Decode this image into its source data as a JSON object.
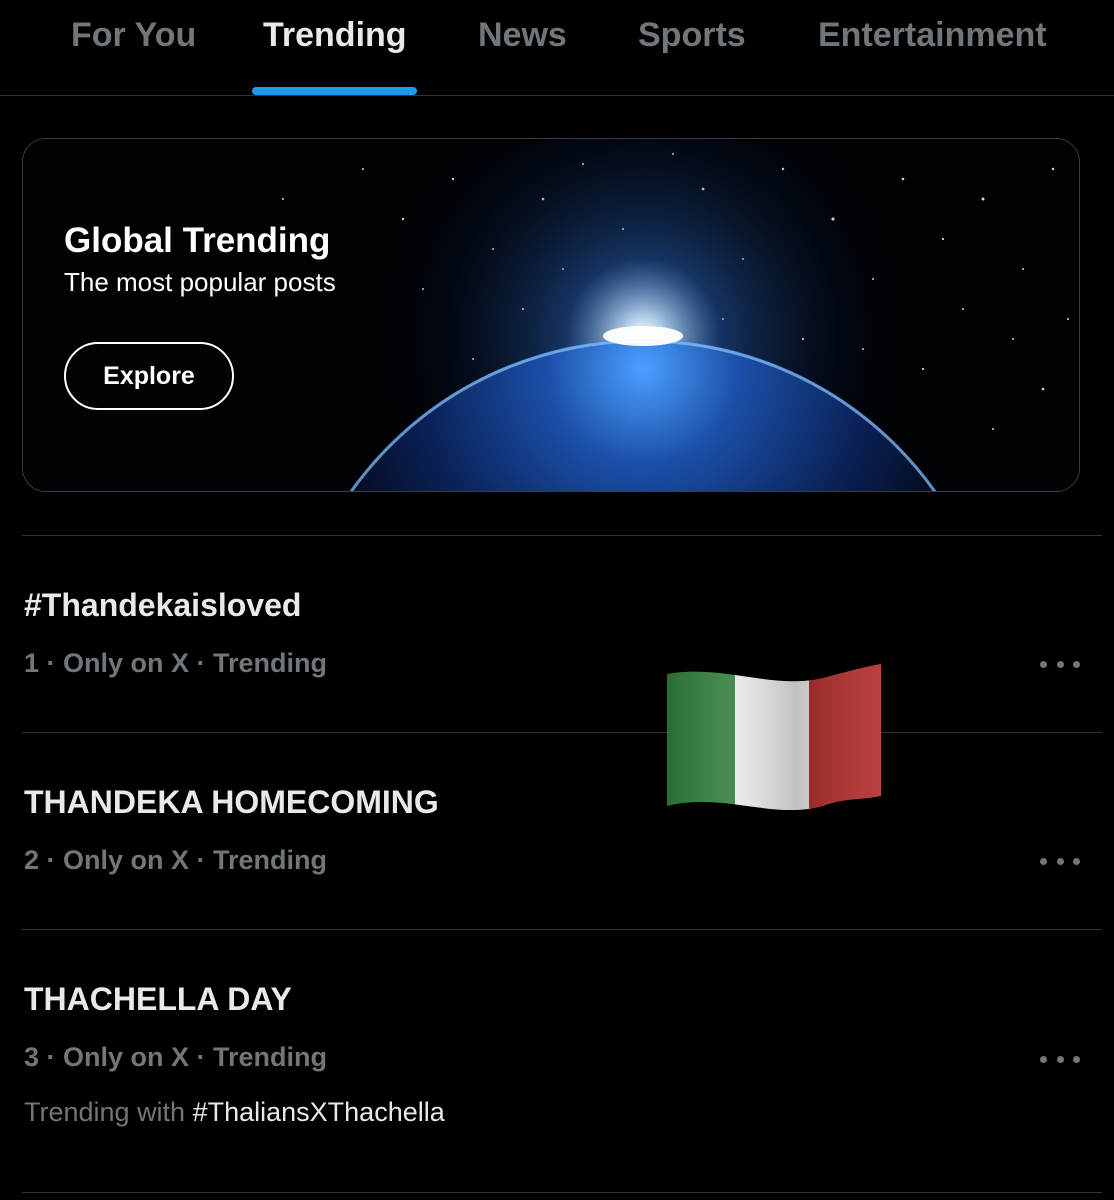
{
  "tabs": [
    {
      "label": "For You",
      "active": false
    },
    {
      "label": "Trending",
      "active": true
    },
    {
      "label": "News",
      "active": false
    },
    {
      "label": "Sports",
      "active": false
    },
    {
      "label": "Entertainment",
      "active": false
    }
  ],
  "banner": {
    "title": "Global Trending",
    "subtitle": "The most popular posts",
    "button_label": "Explore",
    "image": "earth-from-space"
  },
  "trends": [
    {
      "title": "#Thandekaisloved",
      "meta": "1 · Only on X · Trending"
    },
    {
      "title": "THANDEKA HOMECOMING",
      "meta": "2 · Only on X · Trending"
    },
    {
      "title": "THACHELLA DAY",
      "meta": "3 · Only on X · Trending",
      "with_prefix": "Trending with ",
      "with_tag": "#ThaliansXThachella"
    }
  ],
  "overlay": {
    "icon": "italy-flag-icon"
  },
  "colors": {
    "background": "#000000",
    "accent": "#1d9bf0",
    "text": "#e7e9ea",
    "muted": "#71767b",
    "divider": "#2f3336"
  }
}
